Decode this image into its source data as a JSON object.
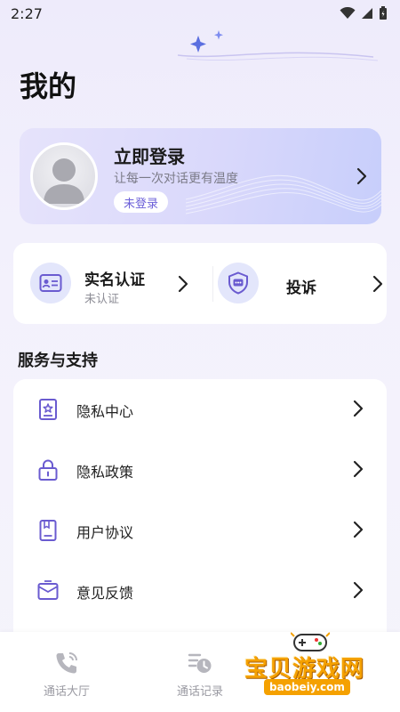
{
  "status": {
    "time": "2:27"
  },
  "header": {
    "title": "我的"
  },
  "profile": {
    "title": "立即登录",
    "subtitle": "让每一次对话更有温度",
    "badge": "未登录"
  },
  "quick": {
    "verify": {
      "title": "实名认证",
      "status": "未认证"
    },
    "complaint": {
      "title": "投诉"
    }
  },
  "services": {
    "title": "服务与支持",
    "items": [
      {
        "label": "隐私中心",
        "icon": "privacy-center-icon"
      },
      {
        "label": "隐私政策",
        "icon": "lock-icon"
      },
      {
        "label": "用户协议",
        "icon": "document-icon"
      },
      {
        "label": "意见反馈",
        "icon": "feedback-icon"
      }
    ]
  },
  "nav": {
    "items": [
      {
        "label": "通话大厅",
        "icon": "phone-icon"
      },
      {
        "label": "通话记录",
        "icon": "call-log-icon"
      }
    ]
  },
  "watermark": {
    "text": "宝贝游戏网",
    "url": "baobeiy.com"
  },
  "colors": {
    "accent": "#6b5fd8",
    "icon_purple": "#6a5bd0",
    "card_bg": "#ffffff",
    "page_bg": "#f3f1fc"
  }
}
